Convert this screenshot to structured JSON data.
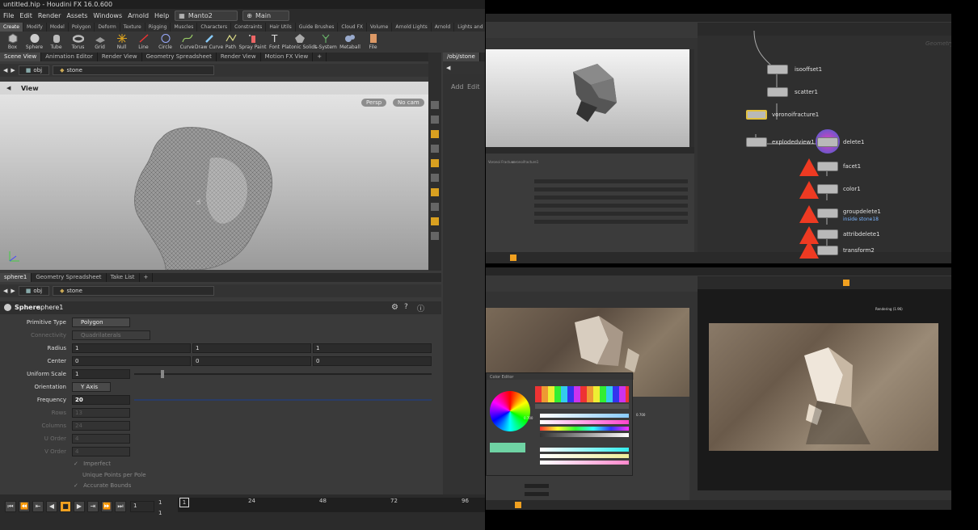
{
  "window": {
    "title": "untitled.hip - Houdini FX 16.0.600"
  },
  "menu": [
    "File",
    "Edit",
    "Render",
    "Assets",
    "Windows",
    "Arnold",
    "Help"
  ],
  "desktop": {
    "value": "Manto2"
  },
  "context": {
    "value": "Main"
  },
  "shelf_tabs": [
    "Create",
    "Modify",
    "Model",
    "Polygon",
    "Deform",
    "Texture",
    "Rigging",
    "Muscles",
    "Characters",
    "Constraints",
    "Hair Utils",
    "Guide Brushes",
    "Cloud FX",
    "Volume",
    "Arnold Lights",
    "Arnold",
    "Lights and"
  ],
  "tools": [
    "Box",
    "Sphere",
    "Tube",
    "Torus",
    "Grid",
    "Null",
    "Line",
    "Circle",
    "Curve",
    "Draw Curve",
    "Path",
    "Spray Paint",
    "Font",
    "Platonic Solids",
    "L-System",
    "Metaball",
    "File"
  ],
  "scene_tabs": [
    "Scene View",
    "Animation Editor",
    "Render View",
    "Geometry Spreadsheet",
    "Render View",
    "Motion FX View"
  ],
  "path": {
    "obj": "obj",
    "node": "stone"
  },
  "viewport": {
    "label": "View",
    "persp": "Persp",
    "cam": "No cam"
  },
  "net_path": "/obj/stone",
  "net_buttons": {
    "add": "Add",
    "edit": "Edit"
  },
  "param_tabs": [
    "sphere1",
    "Geometry Spreadsheet",
    "Take List"
  ],
  "node_type": "Sphere",
  "node_name": "sphere1",
  "params": {
    "primitive_type": {
      "label": "Primitive Type",
      "value": "Polygon"
    },
    "connectivity": {
      "label": "Connectivity",
      "value": "Quadrilaterals"
    },
    "radius": {
      "label": "Radius",
      "x": "1",
      "y": "1",
      "z": "1"
    },
    "center": {
      "label": "Center",
      "x": "0",
      "y": "0",
      "z": "0"
    },
    "uniform_scale": {
      "label": "Uniform Scale",
      "value": "1"
    },
    "orientation": {
      "label": "Orientation",
      "value": "Y Axis"
    },
    "frequency": {
      "label": "Frequency",
      "value": "20"
    },
    "rows": {
      "label": "Rows",
      "value": "13"
    },
    "columns": {
      "label": "Columns",
      "value": "24"
    },
    "u_order": {
      "label": "U Order",
      "value": "4"
    },
    "v_order": {
      "label": "V Order",
      "value": "4"
    },
    "imperfect": "Imperfect",
    "unique_points": "Unique Points per Pole",
    "accurate_bounds": "Accurate Bounds"
  },
  "timeline": {
    "frame": "1",
    "start": "1",
    "end": "1",
    "ticks": [
      "1",
      "24",
      "48",
      "72",
      "96"
    ]
  },
  "nodes": [
    {
      "label": "isooffset1"
    },
    {
      "label": "scatter1"
    },
    {
      "label": "voronoifracture1"
    },
    {
      "label": "explodedview1"
    },
    {
      "label": "delete1"
    },
    {
      "label": "facet1"
    },
    {
      "label": "color1"
    },
    {
      "label": "groupdelete1",
      "sub": "inside stone18"
    },
    {
      "label": "attribdelete1"
    },
    {
      "label": "transform2"
    }
  ],
  "panel2_header": "Voronoi Fracture",
  "panel2_node": "voronoifracture1",
  "color_editor": {
    "title": "Color Editor",
    "value": "0.700",
    "num": "0.700"
  },
  "render_header": "Rendering (1.96)",
  "network_label": "Geometry",
  "colors": {
    "accent": "#f0a020",
    "warning": "#ee3a22",
    "selected": "#e0c040",
    "bg": "#3a3a3a"
  }
}
